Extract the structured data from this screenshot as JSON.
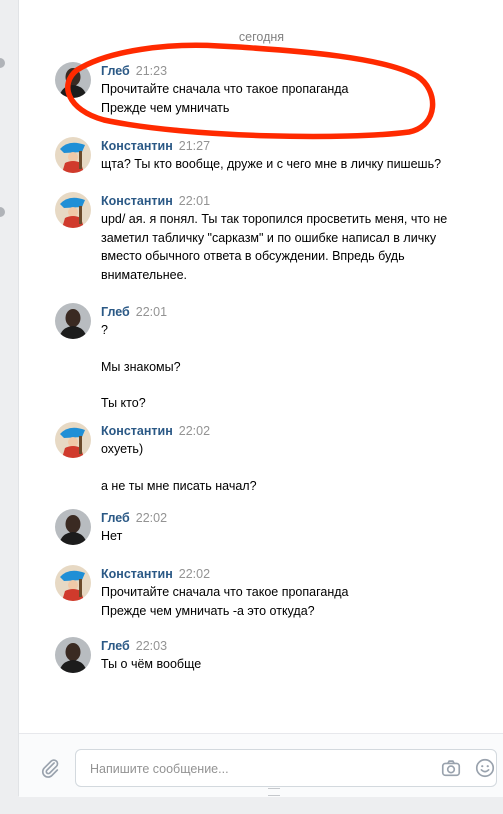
{
  "chat": {
    "date_label": "сегодня",
    "messages": [
      {
        "author": "Глеб",
        "time": "21:23",
        "avatar": "gleb-avatar",
        "lines": [
          "Прочитайте сначала что такое пропаганда",
          "Прежде чем умничать"
        ]
      },
      {
        "author": "Константин",
        "time": "21:27",
        "avatar": "konstantin-avatar",
        "lines": [
          "щта? Ты кто вообще, друже и с чего мне в личку пишешь?"
        ]
      },
      {
        "author": "Константин",
        "time": "22:01",
        "avatar": "konstantin-avatar",
        "lines": [
          "upd/ ая. я понял. Ты так торопился просветить меня, что не",
          "заметил табличку \"сарказм\" и по ошибке написал в личку",
          "вместо обычного ответа в обсуждении. Впредь будь",
          "внимательнее."
        ]
      },
      {
        "author": "Глеб",
        "time": "22:01",
        "avatar": "gleb-avatar",
        "lines": [
          "?",
          "",
          "Мы знакомы?",
          "",
          "Ты кто?"
        ]
      },
      {
        "author": "Константин",
        "time": "22:02",
        "avatar": "konstantin-avatar",
        "lines": [
          "охуеть)",
          "",
          "а не ты мне писать начал?"
        ]
      },
      {
        "author": "Глеб",
        "time": "22:02",
        "avatar": "gleb-avatar",
        "lines": [
          "Нет"
        ]
      },
      {
        "author": "Константин",
        "time": "22:02",
        "avatar": "konstantin-avatar",
        "lines": [
          "Прочитайте сначала что такое пропаганда",
          "Прежде чем умничать -а это откуда?"
        ]
      },
      {
        "author": "Глеб",
        "time": "22:03",
        "avatar": "gleb-avatar",
        "lines": [
          "Ты о чём вообще"
        ]
      }
    ]
  },
  "composer": {
    "placeholder": "Напишите сообщение...",
    "attach_icon": "paperclip-icon",
    "camera_icon": "camera-icon",
    "emoji_icon": "smile-icon"
  },
  "colors": {
    "author": "#2a5885",
    "time": "#939393",
    "highlight": "#ff2a00",
    "background": "#edeef0"
  }
}
